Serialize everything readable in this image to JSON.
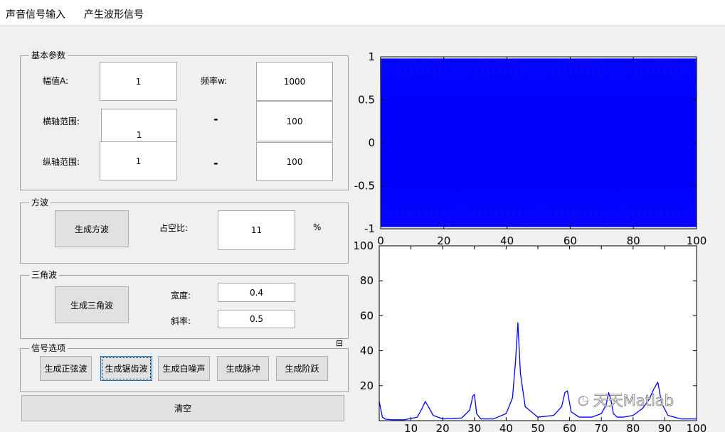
{
  "menu": {
    "items": [
      "声音信号输入",
      "产生波形信号"
    ]
  },
  "params": {
    "title": "基本参数",
    "amplitude_label": "幅值A:",
    "amplitude_value": "1",
    "frequency_label": "频率w:",
    "frequency_value": "1000",
    "xrange_label": "横轴范围:",
    "xrange_min": "1",
    "xrange_max": "100",
    "yrange_label": "纵轴范围:",
    "yrange_min": "1",
    "yrange_max": "100",
    "dash": "-"
  },
  "square": {
    "title": "方波",
    "button": "生成方波",
    "duty_label": "占空比:",
    "duty_value": "11",
    "percent": "%"
  },
  "triangle": {
    "title": "三角波",
    "button": "生成三角波",
    "width_label": "宽度:",
    "width_value": "0.4",
    "slope_label": "斜率:",
    "slope_value": "0.5"
  },
  "signal": {
    "title": "信号选项",
    "buttons": [
      "生成正弦波",
      "生成锯齿波",
      "生成白噪声",
      "生成脉冲",
      "生成阶跃"
    ]
  },
  "clear_button": "清空",
  "watermark": "天天Matlab",
  "colors": {
    "series": "#0000ff",
    "window": "#f0f0f0"
  },
  "chart_data": [
    {
      "type": "line",
      "title": "",
      "xlabel": "",
      "ylabel": "",
      "xlim": [
        0,
        100
      ],
      "ylim": [
        -1,
        1
      ],
      "xticks": [
        0,
        20,
        40,
        60,
        80,
        100
      ],
      "yticks": [
        -1,
        -0.5,
        0,
        0.5,
        1
      ],
      "xtick_labels": [
        "0",
        "20",
        "40",
        "60",
        "80",
        "100"
      ],
      "ytick_labels": [
        "-1",
        "-0.5",
        "0",
        "0.5",
        "1"
      ],
      "series": [
        {
          "description": "dense oscillation between -0.98 and 0.98 filling the axes",
          "freq": 1000,
          "amplitude": 0.98
        }
      ]
    },
    {
      "type": "line",
      "title": "",
      "xlabel": "",
      "ylabel": "",
      "xlim": [
        0,
        100
      ],
      "ylim": [
        0,
        100
      ],
      "xticks": [
        10,
        20,
        30,
        40,
        50,
        60,
        70,
        80,
        90,
        100
      ],
      "yticks": [
        20,
        40,
        60,
        80,
        100
      ],
      "xtick_labels": [
        "10",
        "20",
        "30",
        "40",
        "50",
        "60",
        "70",
        "80",
        "90",
        "100"
      ],
      "ytick_labels": [
        "20",
        "40",
        "60",
        "80",
        "100"
      ],
      "series": [
        {
          "x": [
            0,
            1,
            2,
            4,
            8,
            12,
            13.5,
            14.5,
            15.5,
            17,
            20,
            26,
            28.5,
            29.5,
            30,
            30.7,
            32,
            36,
            40,
            42,
            43,
            43.7,
            44.5,
            46,
            50,
            55,
            57.5,
            58.5,
            59.3,
            60.5,
            63,
            67,
            70,
            71.5,
            72.3,
            73,
            73.8,
            75,
            77,
            80,
            83,
            85,
            86.5,
            87.8,
            89,
            91,
            95,
            100
          ],
          "y": [
            11,
            2,
            0.8,
            0.5,
            0.5,
            2,
            7,
            11,
            8,
            3,
            1,
            1.5,
            6,
            14,
            15,
            4,
            1,
            1,
            4,
            13,
            35,
            56,
            27,
            8,
            2,
            3,
            8,
            16,
            17,
            5,
            2,
            2,
            4,
            9,
            16,
            12,
            4,
            2,
            2,
            3,
            7,
            12,
            18,
            22,
            10,
            3,
            1,
            1
          ]
        }
      ]
    }
  ]
}
